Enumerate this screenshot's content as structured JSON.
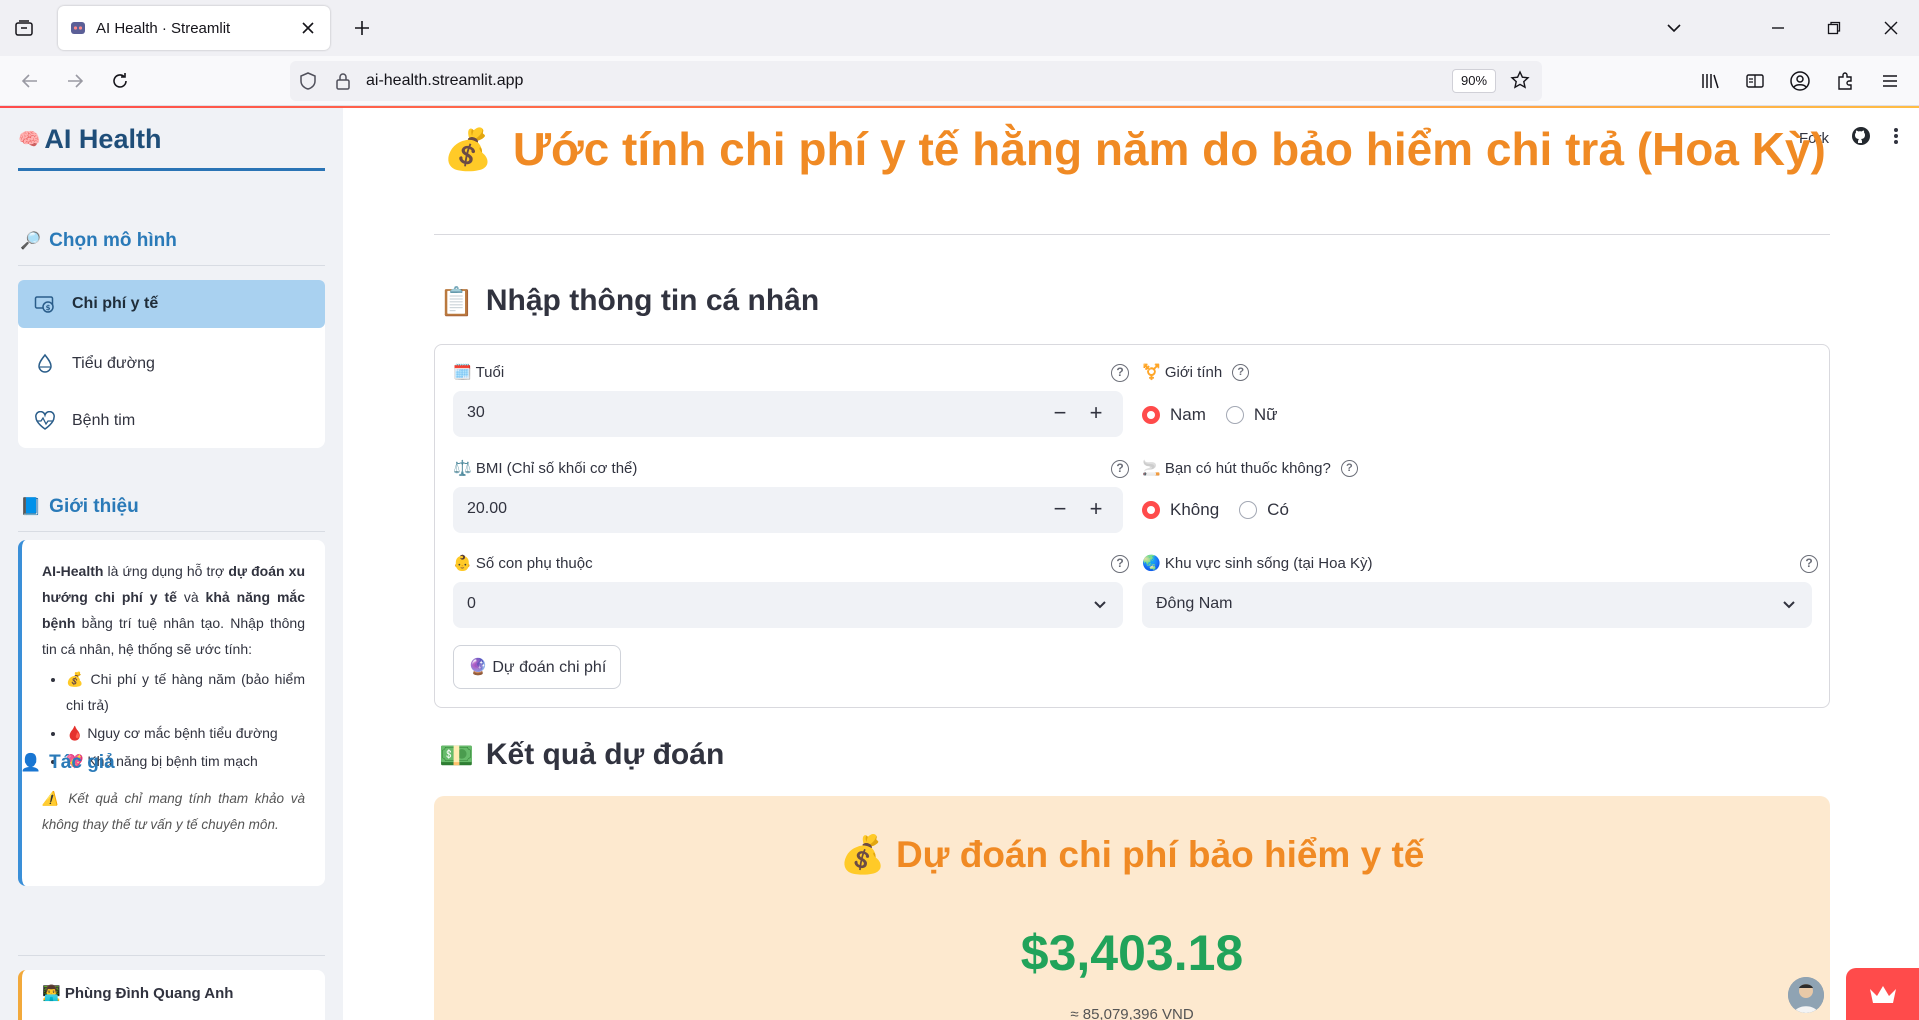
{
  "browser": {
    "tab_title": "AI Health · Streamlit",
    "url": "ai-health.streamlit.app",
    "zoom": "90%"
  },
  "colors": {
    "accent_orange": "#f08a24",
    "accent_blue": "#2a7ab8",
    "streamlit_red": "#ff4b4b",
    "success_green": "#21a35a"
  },
  "sidebar": {
    "app_title": "AI Health",
    "model_section": "Chọn mô hình",
    "menu": [
      {
        "label": "Chi phí y tế",
        "icon": "cash-icon",
        "active": true
      },
      {
        "label": "Tiểu đường",
        "icon": "droplet-icon",
        "active": false
      },
      {
        "label": "Bệnh tim",
        "icon": "heartbeat-icon",
        "active": false
      }
    ],
    "intro_section": "Giới thiệu",
    "intro": {
      "p1_bold1": "AI-Health",
      "p1_text1": " là ứng dụng hỗ trợ ",
      "p1_bold2": "dự đoán xu hướng chi phí y tế",
      "p1_text2": " và ",
      "p1_bold3": "khả năng mắc bệnh",
      "p1_text3": " bằng trí tuệ nhân tạo. Nhập thông tin cá nhân, hệ thống sẽ ước tính:",
      "items": [
        "💰 Chi phí y tế hàng năm (bảo hiểm chi trả)",
        "🩸 Nguy cơ mắc bệnh tiểu đường",
        "💖 Khả năng bị bệnh tim mạch"
      ],
      "note": "⚠️ Kết quả chỉ mang tính tham khảo và không thay thế tư vấn y tế chuyên môn."
    },
    "author_section": "Tác giả",
    "author": "👨‍💻 Phùng Đình Quang Anh"
  },
  "header": {
    "fork_label": "Fork"
  },
  "main": {
    "title_emoji": "💰",
    "title": "Ước tính chi phí y tế hằng năm do bảo hiểm chi trả (Hoa Kỳ)",
    "form_heading_emoji": "📋",
    "form_heading": "Nhập thông tin cá nhân",
    "fields": {
      "age": {
        "label": "🗓️ Tuổi",
        "value": "30"
      },
      "sex": {
        "label": "⚧️ Giới tính",
        "options": [
          "Nam",
          "Nữ"
        ],
        "selected": "Nam"
      },
      "bmi": {
        "label": "⚖️ BMI (Chỉ số khối cơ thể)",
        "value": "20.00"
      },
      "smoker": {
        "label": "🚬 Bạn có hút thuốc không?",
        "options": [
          "Không",
          "Có"
        ],
        "selected": "Không"
      },
      "children": {
        "label": "👶 Số con phụ thuộc",
        "value": "0"
      },
      "region": {
        "label": "🌏 Khu vực sinh sống (tại Hoa Kỳ)",
        "value": "Đông Nam"
      }
    },
    "predict_button": "🔮 Dự đoán chi phí",
    "result_heading_emoji": "💵",
    "result_heading": "Kết quả dự đoán",
    "result_title": "💰 Dự đoán chi phí bảo hiểm y tế",
    "result_value": "$3,403.18",
    "result_sub": "≈ 85,079,396 VND"
  }
}
